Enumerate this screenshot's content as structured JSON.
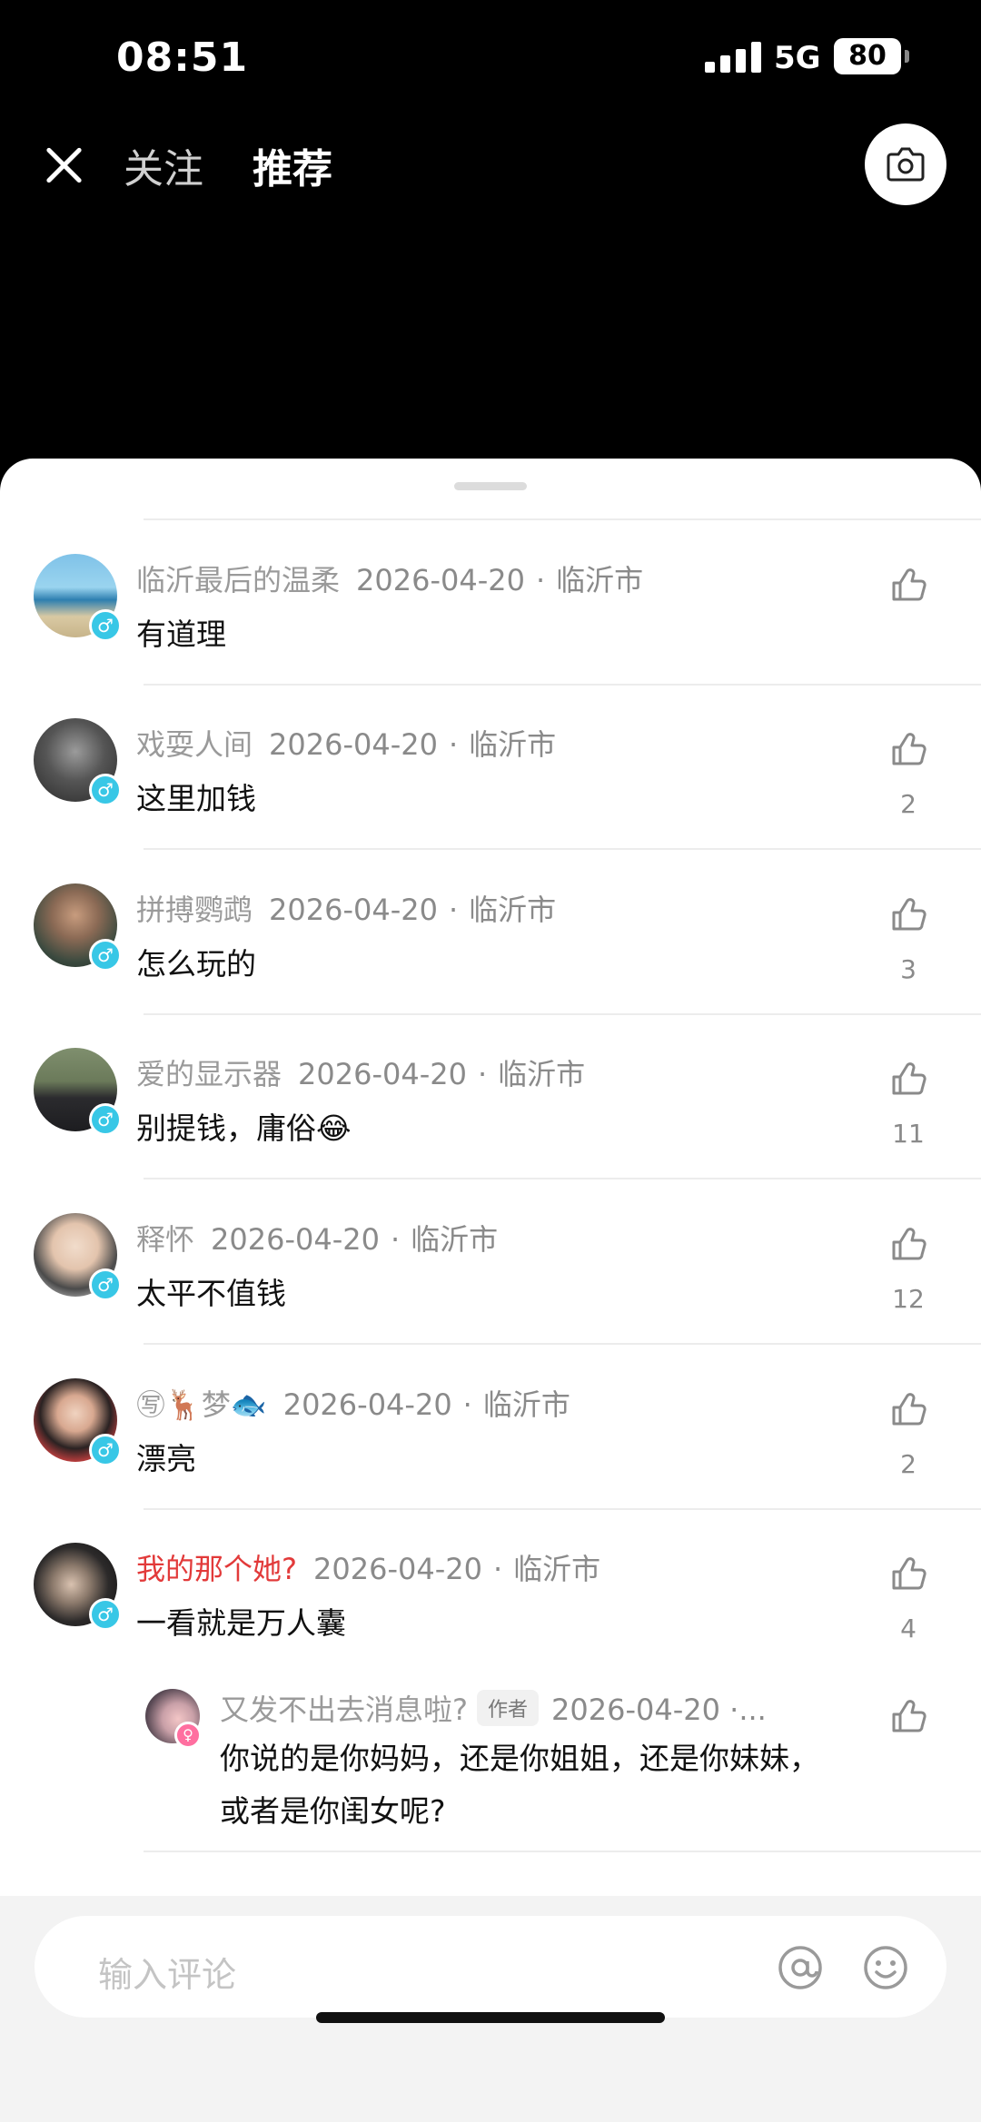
{
  "status_bar": {
    "time": "08:51",
    "network": "5G",
    "battery": "80"
  },
  "nav": {
    "tab_follow": "关注",
    "tab_recommend": "推荐"
  },
  "comments": [
    {
      "name": "临沂最后的温柔",
      "date": "2026-04-20",
      "location": "临沂市",
      "text": "有道理",
      "likes": ""
    },
    {
      "name": "戏耍人间",
      "date": "2026-04-20",
      "location": "临沂市",
      "text": "这里加钱",
      "likes": "2"
    },
    {
      "name": "拼搏鹦鹉",
      "date": "2026-04-20",
      "location": "临沂市",
      "text": "怎么玩的",
      "likes": "3"
    },
    {
      "name": "爱的显示器",
      "date": "2026-04-20",
      "location": "临沂市",
      "text": "别提钱，庸俗😂",
      "likes": "11"
    },
    {
      "name": "释怀",
      "date": "2026-04-20",
      "location": "临沂市",
      "text": "太平不值钱",
      "likes": "12"
    },
    {
      "name": "㊢🦌梦🐟",
      "date": "2026-04-20",
      "location": "临沂市",
      "text": "漂亮",
      "likes": "2"
    },
    {
      "name": "我的那个她?",
      "date": "2026-04-20",
      "location": "临沂市",
      "text": "一看就是万人囊",
      "likes": "4"
    }
  ],
  "reply": {
    "name": "又发不出去消息啦?",
    "tag": "作者",
    "date_trunc": "2026-04-20 ·...",
    "text": "你说的是你妈妈，还是你姐姐，还是你妹妹，或者是你闺女呢?"
  },
  "input": {
    "placeholder": "输入评论"
  },
  "colors": {
    "accent_gender": "#38c7e6",
    "highlight_name": "#e23a3a"
  }
}
